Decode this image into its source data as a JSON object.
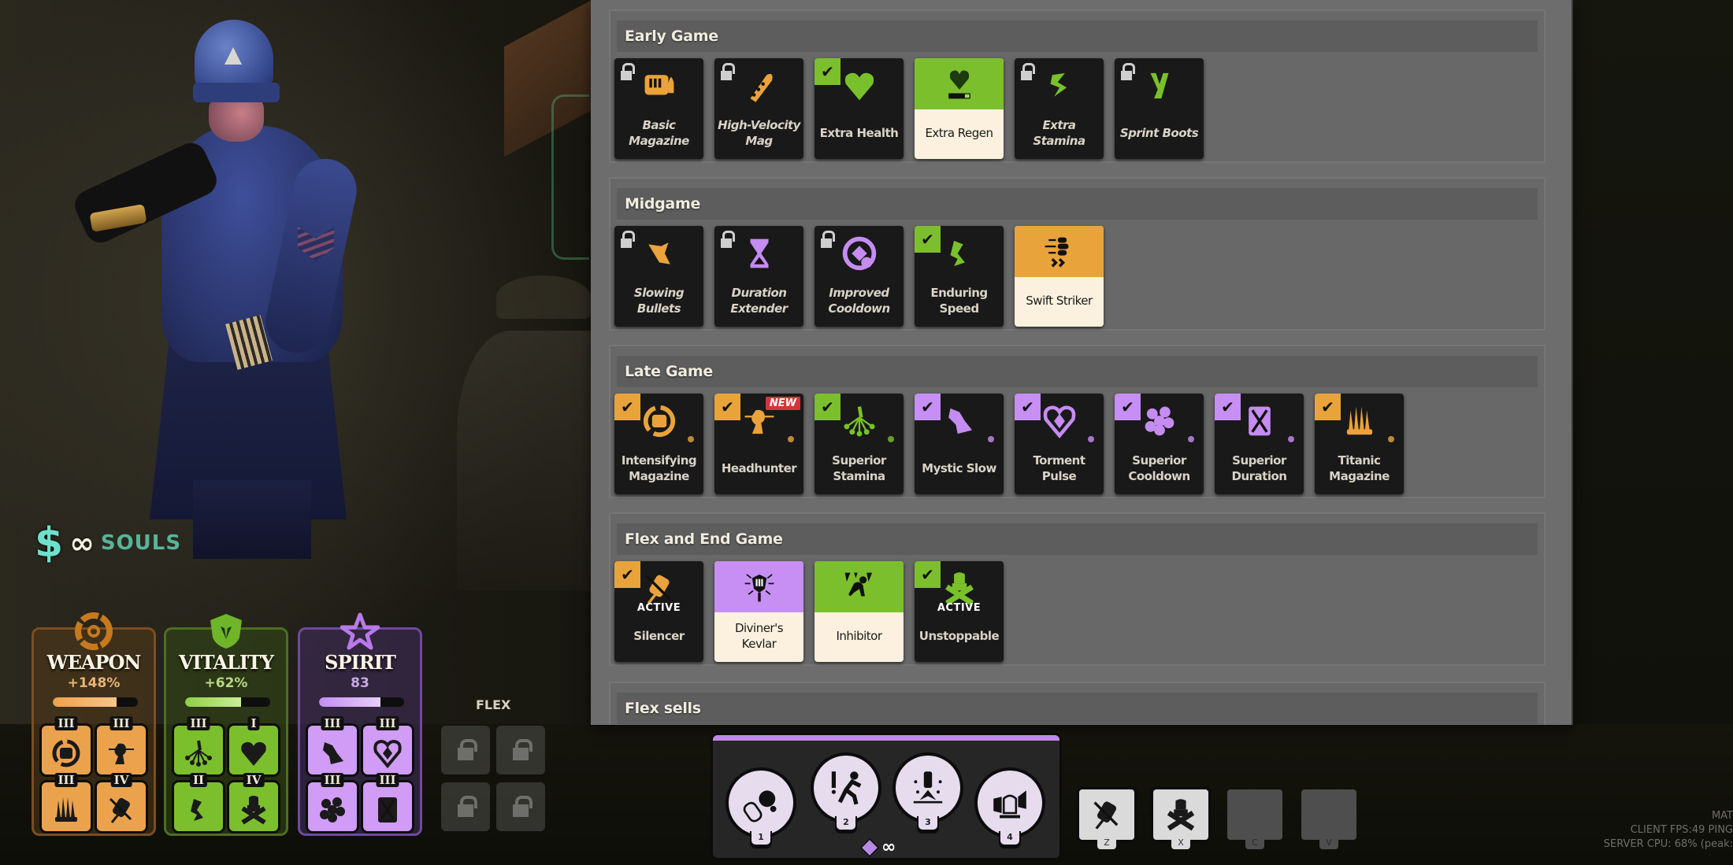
{
  "build": {
    "sections": [
      {
        "title": "Early Game",
        "items": [
          {
            "name": "Basic Magazine",
            "category": "weapon",
            "state": "locked",
            "icon": "magazine-icon"
          },
          {
            "name": "High-Velocity Mag",
            "category": "weapon",
            "state": "locked",
            "icon": "bullet-velocity-icon"
          },
          {
            "name": "Extra Health",
            "category": "vitality",
            "state": "owned",
            "icon": "heart-icon"
          },
          {
            "name": "Extra Regen",
            "category": "vitality",
            "state": "highlighted",
            "icon": "heart-regen-icon"
          },
          {
            "name": "Extra Stamina",
            "category": "vitality",
            "state": "locked",
            "icon": "stamina-icon"
          },
          {
            "name": "Sprint Boots",
            "category": "vitality",
            "state": "locked",
            "icon": "boots-icon"
          }
        ]
      },
      {
        "title": "Midgame",
        "items": [
          {
            "name": "Slowing Bullets",
            "category": "weapon",
            "state": "locked",
            "icon": "slowing-bullets-icon"
          },
          {
            "name": "Duration Extender",
            "category": "spirit",
            "state": "locked",
            "icon": "hourglass-icon"
          },
          {
            "name": "Improved Cooldown",
            "category": "spirit",
            "state": "locked",
            "icon": "cooldown-icon"
          },
          {
            "name": "Enduring Speed",
            "category": "vitality",
            "state": "owned",
            "icon": "speed-icon"
          },
          {
            "name": "Swift Striker",
            "category": "weapon",
            "state": "highlighted",
            "icon": "swift-striker-icon"
          }
        ]
      },
      {
        "title": "Late Game",
        "items": [
          {
            "name": "Intensifying Magazine",
            "category": "weapon",
            "state": "owned",
            "icon": "intensifying-magazine-icon"
          },
          {
            "name": "Headhunter",
            "category": "weapon",
            "state": "owned",
            "badge": "NEW",
            "icon": "headhunter-icon"
          },
          {
            "name": "Superior Stamina",
            "category": "vitality",
            "state": "owned",
            "icon": "superior-stamina-icon"
          },
          {
            "name": "Mystic Slow",
            "category": "spirit",
            "state": "owned",
            "icon": "mystic-slow-icon"
          },
          {
            "name": "Torment Pulse",
            "category": "spirit",
            "state": "owned",
            "icon": "torment-pulse-icon"
          },
          {
            "name": "Superior Cooldown",
            "category": "spirit",
            "state": "owned",
            "icon": "superior-cooldown-icon"
          },
          {
            "name": "Superior Duration",
            "category": "spirit",
            "state": "owned",
            "icon": "superior-duration-icon"
          },
          {
            "name": "Titanic Magazine",
            "category": "weapon",
            "state": "owned",
            "icon": "titanic-magazine-icon"
          }
        ]
      },
      {
        "title": "Flex and End Game",
        "items": [
          {
            "name": "Silencer",
            "category": "weapon",
            "state": "owned",
            "tag": "ACTIVE",
            "icon": "silencer-icon"
          },
          {
            "name": "Diviner's Kevlar",
            "category": "spirit",
            "state": "highlighted",
            "icon": "diviners-kevlar-icon"
          },
          {
            "name": "Inhibitor",
            "category": "vitality",
            "state": "highlighted",
            "icon": "inhibitor-icon"
          },
          {
            "name": "Unstoppable",
            "category": "vitality",
            "state": "owned",
            "tag": "ACTIVE",
            "icon": "unstoppable-icon"
          }
        ]
      },
      {
        "title": "Flex sells",
        "items": []
      }
    ]
  },
  "souls": {
    "amount_symbol": "∞",
    "label": "SOULS"
  },
  "stats": {
    "weapon": {
      "title": "WEAPON",
      "value": "+148%",
      "fill": 0.75
    },
    "vitality": {
      "title": "VITALITY",
      "value": "+62%",
      "fill": 0.66
    },
    "spirit": {
      "title": "SPIRIT",
      "value": "83",
      "fill": 0.72
    }
  },
  "slots": {
    "weapon": [
      {
        "tier": "III",
        "icon": "intensifying-magazine-icon"
      },
      {
        "tier": "III",
        "icon": "headhunter-icon"
      },
      {
        "tier": "III",
        "icon": "titanic-magazine-icon"
      },
      {
        "tier": "IV",
        "icon": "silencer-icon"
      }
    ],
    "vitality": [
      {
        "tier": "III",
        "icon": "superior-stamina-icon"
      },
      {
        "tier": "I",
        "icon": "heart-icon"
      },
      {
        "tier": "II",
        "icon": "speed-icon"
      },
      {
        "tier": "IV",
        "icon": "unstoppable-icon"
      }
    ],
    "spirit": [
      {
        "tier": "III",
        "icon": "mystic-slow-icon"
      },
      {
        "tier": "III",
        "icon": "torment-pulse-icon"
      },
      {
        "tier": "III",
        "icon": "superior-cooldown-icon"
      },
      {
        "tier": "III",
        "icon": "superior-duration-icon"
      }
    ]
  },
  "flex": {
    "label": "FLEX",
    "slots": 4
  },
  "abilities": [
    {
      "key": "1",
      "icon": "grenade-icon"
    },
    {
      "key": "2",
      "icon": "alert-runner-icon"
    },
    {
      "key": "3",
      "icon": "ground-strike-icon"
    },
    {
      "key": "4",
      "icon": "siren-icon"
    }
  ],
  "ability_souls_symbol": "∞",
  "active_items": [
    {
      "key": "Z",
      "filled": true,
      "icon": "silencer-icon"
    },
    {
      "key": "X",
      "filled": true,
      "icon": "unstoppable-icon"
    },
    {
      "key": "C",
      "filled": false
    },
    {
      "key": "V",
      "filled": false
    }
  ],
  "perf": {
    "line1": "MAT",
    "line2": "CLIENT FPS:49   PING",
    "line3": "SERVER CPU: 68% (peak:"
  },
  "colors": {
    "weapon": "#e8a43b",
    "vitality": "#7cbf2c",
    "spirit": "#c78ef3",
    "scrollbar": "#8fbcf5",
    "new_badge": "#d8333a"
  }
}
